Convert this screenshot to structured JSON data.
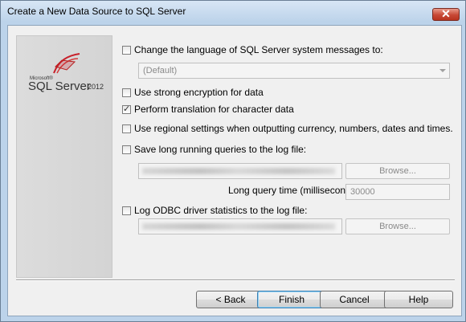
{
  "window": {
    "title": "Create a New Data Source to SQL Server",
    "close_glyph": "✕"
  },
  "logo": {
    "microsoft": "Microsoft®",
    "product": "SQL Server",
    "version": "2012"
  },
  "options": {
    "change_language": {
      "label": "Change the language of SQL Server system messages to:",
      "checked": false
    },
    "language_value": "(Default)",
    "strong_encryption": {
      "label": "Use strong encryption for data",
      "checked": false
    },
    "translation": {
      "label": "Perform translation for character data",
      "checked": true
    },
    "regional": {
      "label": "Use regional settings when outputting currency, numbers, dates and times.",
      "checked": false
    },
    "long_queries": {
      "label": "Save long running queries to the log file:",
      "checked": false
    },
    "long_queries_browse": "Browse...",
    "long_query_time_label": "Long query time (milliseconds):",
    "long_query_time_value": "30000",
    "driver_stats": {
      "label": "Log ODBC driver statistics to the log file:",
      "checked": false
    },
    "driver_stats_browse": "Browse..."
  },
  "buttons": {
    "back": "< Back",
    "finish": "Finish",
    "cancel": "Cancel",
    "help": "Help"
  },
  "icons": [
    "close-icon",
    "sql-server-logo-icon",
    "dropdown-arrow-icon",
    "checkmark-icon"
  ]
}
